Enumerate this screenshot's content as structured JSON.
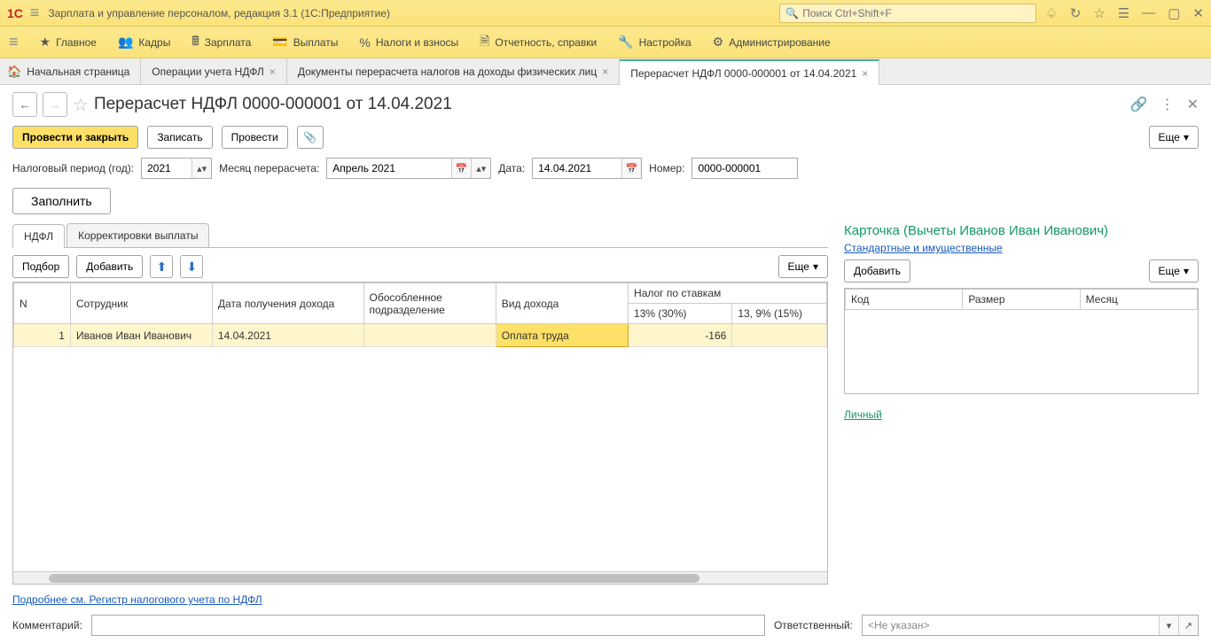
{
  "titlebar": {
    "app_title": "Зарплата и управление персоналом, редакция 3.1  (1С:Предприятие)",
    "search_placeholder": "Поиск Ctrl+Shift+F"
  },
  "mainmenu": {
    "items": [
      {
        "label": "Главное"
      },
      {
        "label": "Кадры"
      },
      {
        "label": "Зарплата"
      },
      {
        "label": "Выплаты"
      },
      {
        "label": "Налоги и взносы"
      },
      {
        "label": "Отчетность, справки"
      },
      {
        "label": "Настройка"
      },
      {
        "label": "Администрирование"
      }
    ]
  },
  "tabs": {
    "home": "Начальная страница",
    "items": [
      {
        "label": "Операции учета НДФЛ"
      },
      {
        "label": "Документы перерасчета налогов на доходы физических лиц"
      },
      {
        "label": "Перерасчет НДФЛ 0000-000001 от 14.04.2021",
        "active": true
      }
    ]
  },
  "page": {
    "title": "Перерасчет НДФЛ 0000-000001 от 14.04.2021"
  },
  "toolbar": {
    "post_close": "Провести и закрыть",
    "save": "Записать",
    "post": "Провести",
    "more": "Еще"
  },
  "form": {
    "period_label": "Налоговый период (год):",
    "period_value": "2021",
    "month_label": "Месяц перерасчета:",
    "month_value": "Апрель 2021",
    "date_label": "Дата:",
    "date_value": "14.04.2021",
    "number_label": "Номер:",
    "number_value": "0000-000001",
    "fill_btn": "Заполнить"
  },
  "tabs2": {
    "ndfl": "НДФЛ",
    "corr": "Корректировки выплаты"
  },
  "grid": {
    "select_btn": "Подбор",
    "add_btn": "Добавить",
    "more": "Еще",
    "headers": {
      "n": "N",
      "employee": "Сотрудник",
      "income_date": "Дата получения дохода",
      "department": "Обособленное подразделение",
      "income_type": "Вид дохода",
      "tax_rates": "Налог по ставкам",
      "rate1": "13% (30%)",
      "rate2": "13, 9% (15%)"
    },
    "rows": [
      {
        "n": "1",
        "employee": "Иванов Иван Иванович",
        "income_date": "14.04.2021",
        "department": "",
        "income_type": "Оплата труда",
        "rate1": "-166",
        "rate2": ""
      }
    ]
  },
  "card": {
    "title": "Карточка (Вычеты Иванов Иван Иванович)",
    "standard_link": "Стандартные и имущественные",
    "add_btn": "Добавить",
    "more": "Еще",
    "headers": {
      "code": "Код",
      "amount": "Размер",
      "month": "Месяц"
    },
    "personal_link": "Личный"
  },
  "footer": {
    "detail_link": "Подробнее см. Регистр налогового учета по НДФЛ",
    "comment_label": "Комментарий:",
    "resp_label": "Ответственный:",
    "resp_placeholder": "<Не указан>"
  }
}
